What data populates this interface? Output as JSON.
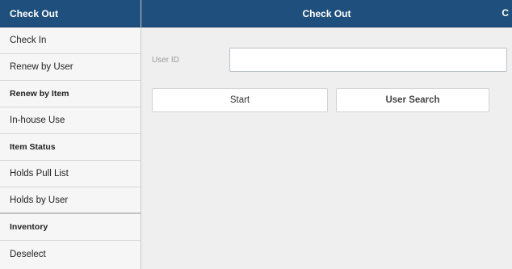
{
  "sidebar": {
    "header": "Check Out",
    "items": [
      {
        "label": "Check In"
      },
      {
        "label": "Renew by User"
      },
      {
        "label": "Renew by Item"
      },
      {
        "label": "In-house Use"
      },
      {
        "label": "Item Status"
      },
      {
        "label": "Holds Pull List"
      },
      {
        "label": "Holds by User"
      },
      {
        "label": "Inventory"
      },
      {
        "label": "Deselect"
      }
    ]
  },
  "main": {
    "title": "Check Out",
    "corner_icon_label": "C",
    "user_id_label": "User ID",
    "user_id_value": "",
    "start_label": "Start",
    "user_search_label": "User Search"
  },
  "colors": {
    "header_bg": "#1f4f7c",
    "main_bg": "#efefef",
    "sidebar_bg": "#f6f6f6"
  }
}
